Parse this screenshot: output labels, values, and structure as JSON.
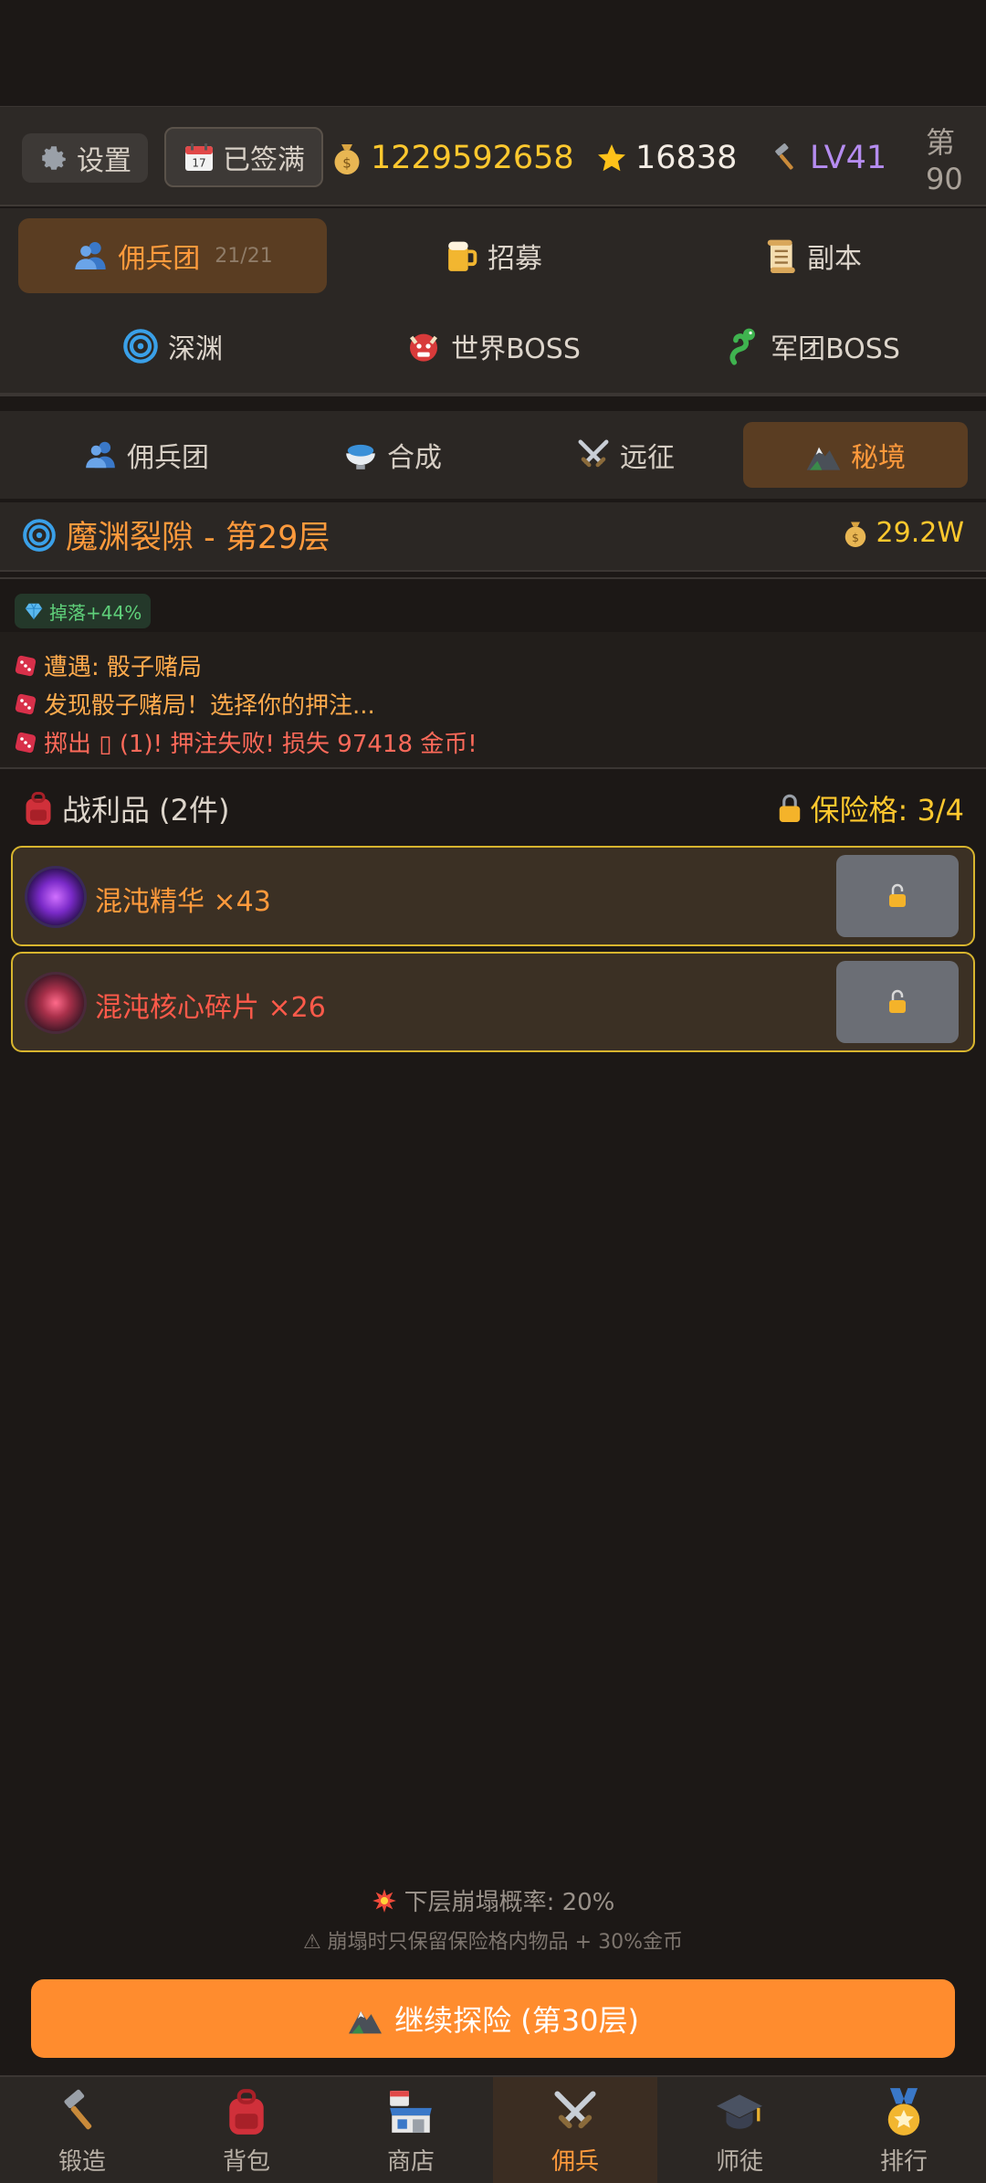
{
  "topbar": {
    "settings_label": "设置",
    "signed_label": "已签满",
    "gold": "1229592658",
    "stars": "16838",
    "level": "LV41",
    "floor_prefix": "第 90"
  },
  "menu": {
    "items": [
      {
        "label": "佣兵团",
        "count": "21/21"
      },
      {
        "label": "招募"
      },
      {
        "label": "副本"
      },
      {
        "label": "深渊"
      },
      {
        "label": "世界BOSS"
      },
      {
        "label": "军团BOSS"
      }
    ]
  },
  "subtabs": [
    {
      "label": "佣兵团"
    },
    {
      "label": "合成"
    },
    {
      "label": "远征"
    },
    {
      "label": "秘境"
    }
  ],
  "dungeon": {
    "title": "魔渊裂隙 - 第29层",
    "gold": "29.2W"
  },
  "drop_badge": "掉落+44%",
  "log": [
    "遭遇: 骰子赌局",
    "发现骰子赌局！选择你的押注...",
    "掷出 ▯ (1)! 押注失败! 损失 97418 金币!"
  ],
  "loot": {
    "title": "战利品 (2件)",
    "safe_slots": "保险格: 3/4",
    "items": [
      {
        "name": "混沌精华 ×43",
        "color": "#ff9a3c"
      },
      {
        "name": "混沌核心碎片 ×26",
        "color": "#ff5a4a"
      }
    ]
  },
  "collapse_rate": "下层崩塌概率: 20%",
  "collapse_note": "⚠ 崩塌时只保留保险格内物品 + 30%金币",
  "continue_label": "继续探险 (第30层)",
  "nav": [
    {
      "label": "锻造"
    },
    {
      "label": "背包"
    },
    {
      "label": "商店"
    },
    {
      "label": "佣兵"
    },
    {
      "label": "师徒"
    },
    {
      "label": "排行"
    }
  ],
  "colors": {
    "accent": "#ff8c2e",
    "gold": "#ffc82e",
    "level": "#b58cf0",
    "background": "#1c1816"
  }
}
